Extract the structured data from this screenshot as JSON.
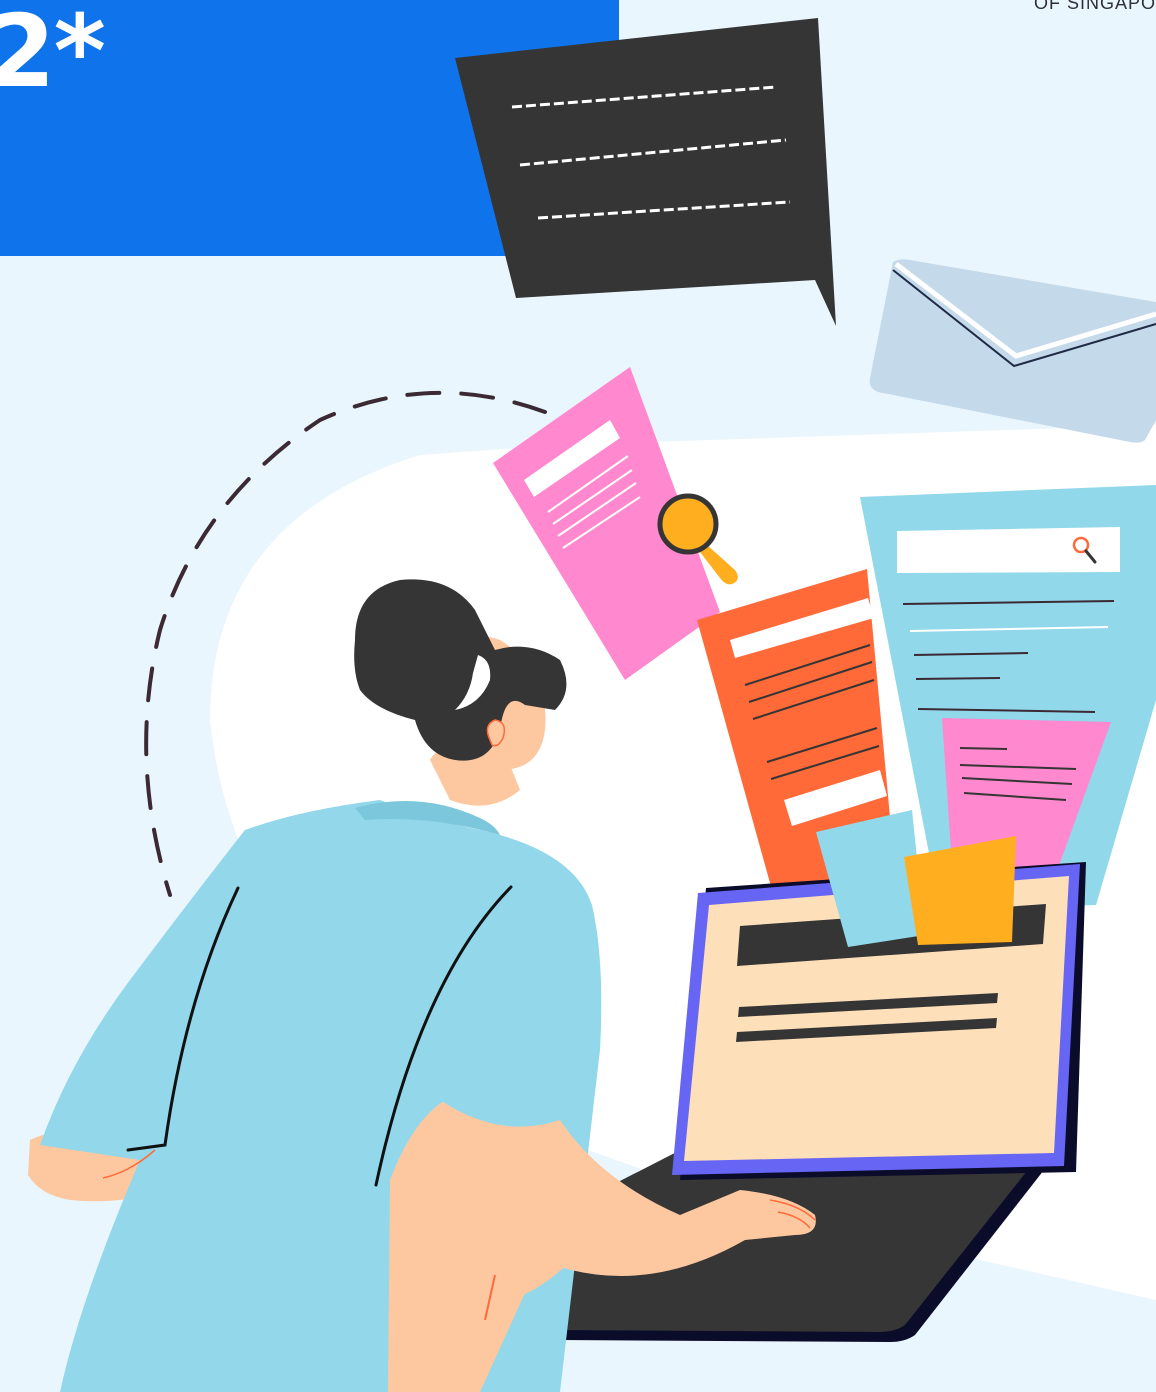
{
  "header": {
    "title": "2*",
    "corner_text": "OF SINGAPO"
  },
  "illustration": {
    "colors": {
      "background": "#eaf6fd",
      "header_band": "#0f74ec",
      "white_blob": "#ffffff",
      "speech_bubble": "#353535",
      "envelope": "#c4d9ea",
      "pink_doc": "#ff88cf",
      "orange_doc": "#ff6a38",
      "blue_doc": "#91d8eb",
      "yellow_card": "#ffae1f",
      "laptop_frame": "#6765f4",
      "laptop_screen": "#fddfb9",
      "laptop_base": "#363636",
      "shirt": "#92d7ea",
      "skin": "#fdc8a0",
      "hair": "#353535"
    }
  }
}
